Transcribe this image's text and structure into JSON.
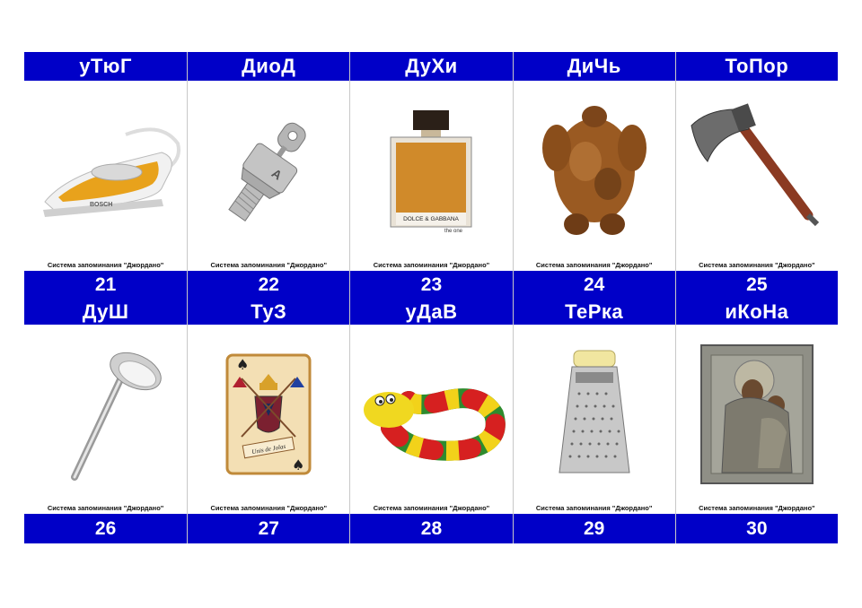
{
  "caption": "Система запоминания \"Джордано\"",
  "accent_color": "#0000c8",
  "cards": [
    {
      "word": "уТюГ",
      "number": "21",
      "icon": "iron-icon"
    },
    {
      "word": "ДиоД",
      "number": "22",
      "icon": "diode-icon"
    },
    {
      "word": "ДуХи",
      "number": "23",
      "icon": "perfume-icon"
    },
    {
      "word": "ДиЧь",
      "number": "24",
      "icon": "roast-bird-icon"
    },
    {
      "word": "ТоПор",
      "number": "25",
      "icon": "axe-icon"
    },
    {
      "word": "ДуШ",
      "number": "26",
      "icon": "shower-head-icon"
    },
    {
      "word": "ТуЗ",
      "number": "27",
      "icon": "ace-card-icon"
    },
    {
      "word": "уДаВ",
      "number": "28",
      "icon": "toy-snake-icon"
    },
    {
      "word": "ТеРка",
      "number": "29",
      "icon": "grater-icon"
    },
    {
      "word": "иКоНа",
      "number": "30",
      "icon": "icon-painting-icon"
    }
  ],
  "brand_texts": {
    "iron": "BOSCH",
    "perfume_brand": "DOLCE & GABBANA",
    "perfume_line": "the one",
    "diode_mark": "A",
    "card_banner": "Unis de Jolas"
  }
}
